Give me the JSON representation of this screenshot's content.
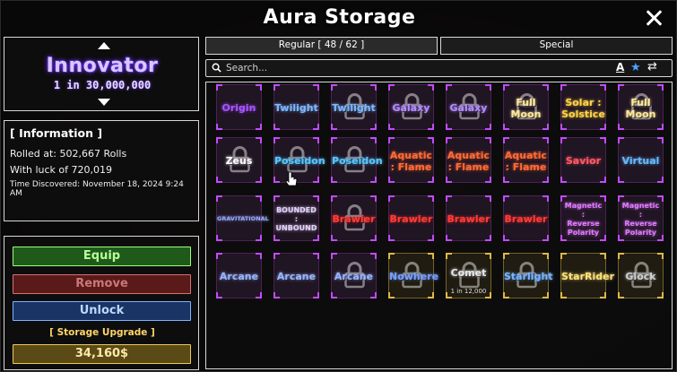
{
  "window": {
    "title": "Aura Storage"
  },
  "preview": {
    "aura_name": "Innovator",
    "aura_rarity": "1 in 30,000,000"
  },
  "info": {
    "title": "[ Information ]",
    "rolled_at": "Rolled at: 502,667 Rolls",
    "luck": "With luck of 720,019",
    "discovered": "Time Discovered: November 18, 2024 9:24 AM"
  },
  "actions": {
    "equip": "Equip",
    "remove": "Remove",
    "unlock": "Unlock",
    "storage_upgrade": "[ Storage Upgrade ]",
    "price": "34,160$"
  },
  "tabs": {
    "regular": "Regular [ 48 / 62 ]",
    "special": "Special"
  },
  "search": {
    "placeholder": "Search..."
  },
  "toolbar_icons": {
    "sort": "A",
    "favorite": "★",
    "swap": "⇄"
  },
  "colors": {
    "accent_purple": "#c24bff",
    "accent_gold": "#e0b845",
    "equip_green": "#9bff7a",
    "remove_red": "#d87070",
    "unlock_blue": "#7fb4ff",
    "upgrade_gold": "#ffd66a"
  },
  "grid": {
    "rows": [
      [
        {
          "label": "Origin",
          "color": "#a855ff",
          "locked": false
        },
        {
          "label": "Twilight",
          "color": "#7fb6ff",
          "locked": false
        },
        {
          "label": "Twilight",
          "color": "#7fb6ff",
          "locked": true
        },
        {
          "label": "Galaxy",
          "color": "#b58cff",
          "locked": true
        },
        {
          "label": "Galaxy",
          "color": "#b58cff",
          "locked": true
        },
        {
          "label": "Full\nMoon",
          "color": "#ffe9a0",
          "locked": true
        },
        {
          "label": "Solar :\nSolstice",
          "color": "#ffd24a",
          "locked": false
        },
        {
          "label": "Full\nMoon",
          "color": "#ffe9a0",
          "locked": true
        }
      ],
      [
        {
          "label": "Zeus",
          "color": "#ffffff",
          "locked": true
        },
        {
          "label": "Poseidon",
          "color": "#5ac6ff",
          "locked": true
        },
        {
          "label": "Poseidon",
          "color": "#5ac6ff",
          "locked": true
        },
        {
          "label": "Aquatic\n: Flame",
          "color": "#ff6a3a",
          "locked": false
        },
        {
          "label": "Aquatic\n: Flame",
          "color": "#ff6a3a",
          "locked": false
        },
        {
          "label": "Aquatic\n: Flame",
          "color": "#ff6a3a",
          "locked": false
        },
        {
          "label": "Savior",
          "color": "#ff5a6a",
          "locked": false
        },
        {
          "label": "Virtual",
          "color": "#6ab8ff",
          "locked": false
        }
      ],
      [
        {
          "label": "GRAVITATIONAL",
          "color": "#9aa8ff",
          "locked": false
        },
        {
          "label": "BOUNDED\n:\nUNBOUND",
          "color": "#e6d4ff",
          "locked": false
        },
        {
          "label": "Brawler",
          "color": "#ff3a3a",
          "locked": true
        },
        {
          "label": "Brawler",
          "color": "#ff3a3a",
          "locked": false
        },
        {
          "label": "Brawler",
          "color": "#ff3a3a",
          "locked": false
        },
        {
          "label": "Brawler",
          "color": "#ff3a3a",
          "locked": false
        },
        {
          "label": "Magnetic\n:\nReverse\nPolarity",
          "color": "#e07aff",
          "locked": false
        },
        {
          "label": "Magnetic\n:\nReverse\nPolarity",
          "color": "#e07aff",
          "locked": false
        }
      ],
      [
        {
          "label": "Arcane",
          "color": "#9ab4ff",
          "locked": false
        },
        {
          "label": "Arcane",
          "color": "#9ab4ff",
          "locked": false
        },
        {
          "label": "Arcane",
          "color": "#9ab4ff",
          "locked": true
        },
        {
          "label": "Nowhere",
          "color": "#7aa0ff",
          "locked": true,
          "gold": true
        },
        {
          "label": "Comet",
          "color": "#e8e8e8",
          "locked": true,
          "gold": true,
          "sub": "1 in 12,000"
        },
        {
          "label": "Starlight",
          "color": "#7ab4ff",
          "locked": true,
          "gold": true
        },
        {
          "label": "StarRider",
          "color": "#ffe27a",
          "locked": false,
          "gold": true
        },
        {
          "label": "Glock",
          "color": "#cfcfcf",
          "locked": true,
          "gold": true
        }
      ]
    ]
  }
}
